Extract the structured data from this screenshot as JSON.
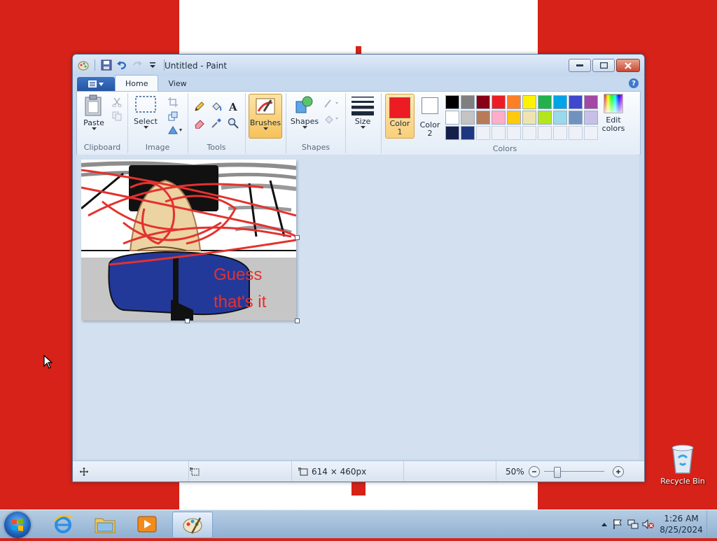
{
  "window": {
    "title": "Untitled - Paint"
  },
  "tabs": {
    "file_icon": "paint-menu-icon",
    "home": "Home",
    "view": "View",
    "help": "?"
  },
  "ribbon": {
    "clipboard": {
      "paste": "Paste",
      "label": "Clipboard"
    },
    "image": {
      "select": "Select",
      "label": "Image"
    },
    "tools": {
      "label": "Tools"
    },
    "brushes": {
      "label": "Brushes"
    },
    "shapes": {
      "button": "Shapes",
      "label": "Shapes"
    },
    "size": {
      "label": "Size"
    },
    "colors": {
      "color1": "Color\n1",
      "color1_line1": "Color",
      "color1_line2": "1",
      "color2_line1": "Color",
      "color2_line2": "2",
      "edit_line1": "Edit",
      "edit_line2": "colors",
      "label": "Colors",
      "color1_value": "#ed1c24",
      "color2_value": "#ffffff",
      "palette": [
        "#000000",
        "#7f7f7f",
        "#880015",
        "#ed1c24",
        "#ff7f27",
        "#fff200",
        "#22b14c",
        "#00a2e8",
        "#3f48cc",
        "#a349a4",
        "#ffffff",
        "#c3c3c3",
        "#b97a57",
        "#ffaec9",
        "#ffc90e",
        "#efe4b0",
        "#b5e61d",
        "#99d9ea",
        "#7092be",
        "#c8bfe7",
        "#14204a",
        "#1f3680",
        "",
        "",
        "",
        "",
        "",
        "",
        "",
        ""
      ]
    }
  },
  "canvas": {
    "text_line1": "Guess",
    "text_line2": "that's it"
  },
  "status": {
    "dimensions": "614 × 460px",
    "zoom": "50%"
  },
  "desktop": {
    "recycle_bin": "Recycle Bin"
  },
  "taskbar": {
    "time": "1:26 AM",
    "date": "8/25/2024"
  }
}
